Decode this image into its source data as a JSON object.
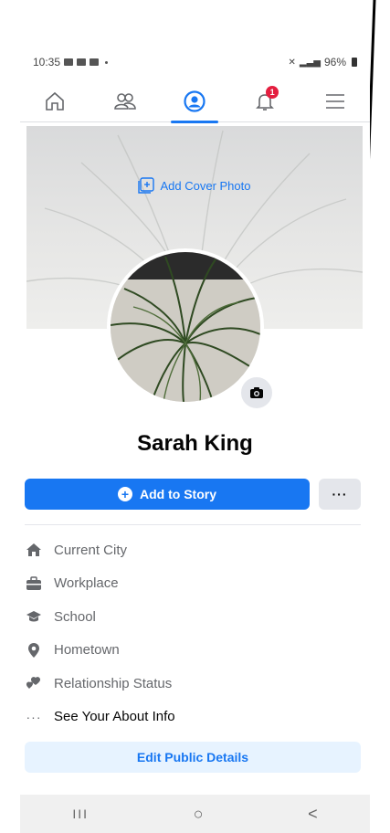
{
  "status_bar": {
    "time": "10:35",
    "battery": "96%"
  },
  "nav": {
    "items": [
      {
        "name": "home",
        "icon": "home-icon"
      },
      {
        "name": "friends",
        "icon": "friends-icon"
      },
      {
        "name": "profile",
        "icon": "profile-icon",
        "active": true
      },
      {
        "name": "notifications",
        "icon": "bell-icon",
        "badge": "1"
      },
      {
        "name": "menu",
        "icon": "menu-icon"
      }
    ]
  },
  "cover": {
    "add_label": "Add Cover Photo"
  },
  "profile": {
    "name": "Sarah King"
  },
  "actions": {
    "add_story_label": "Add to Story",
    "more_label": "···"
  },
  "details": [
    {
      "icon": "house-icon",
      "label": "Current City"
    },
    {
      "icon": "briefcase-icon",
      "label": "Workplace"
    },
    {
      "icon": "graduation-cap-icon",
      "label": "School"
    },
    {
      "icon": "location-pin-icon",
      "label": "Hometown"
    },
    {
      "icon": "hearts-icon",
      "label": "Relationship Status"
    },
    {
      "icon": "ellipsis-icon",
      "label": "See Your About Info"
    }
  ],
  "edit_public_details_label": "Edit Public Details",
  "system_nav": {
    "recents": "III",
    "home": "○",
    "back": "<"
  },
  "colors": {
    "accent": "#1877f2",
    "badge": "#e41e3f",
    "secondary_bg": "#e4e6eb",
    "light_blue": "#e7f3ff"
  }
}
